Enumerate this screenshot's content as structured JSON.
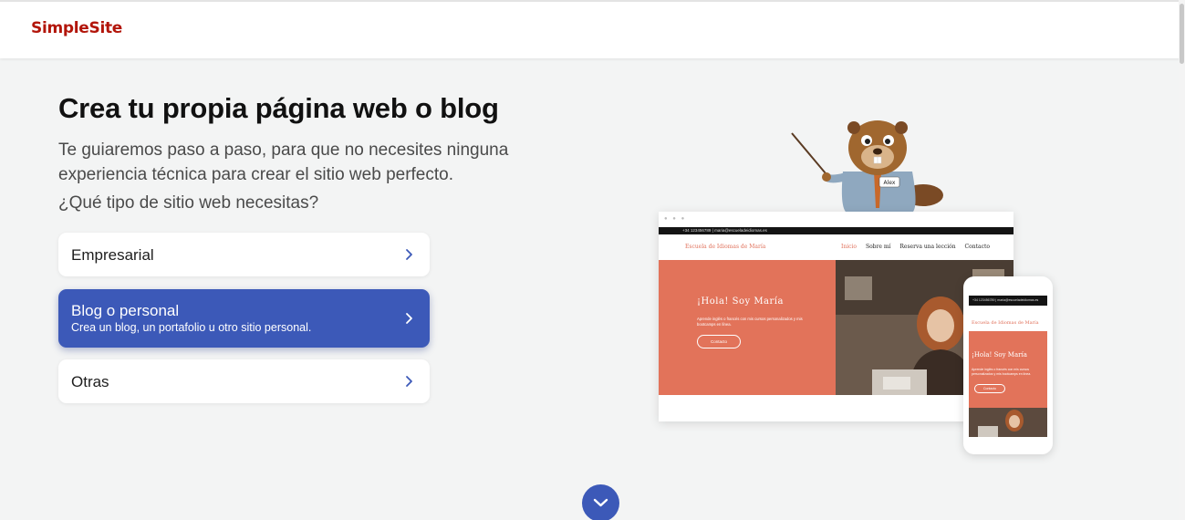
{
  "header": {
    "logo_text": "SimpleSite",
    "logo_color": "#b2150a"
  },
  "main": {
    "headline": "Crea tu propia página web o blog",
    "subtitle": "Te guiaremos paso a paso, para que no necesites ninguna experiencia técnica para crear el sitio web perfecto.",
    "question": "¿Qué tipo de sitio web necesitas?",
    "options": [
      {
        "label": "Empresarial",
        "description": "",
        "selected": false
      },
      {
        "label": "Blog o personal",
        "description": "Crea un blog, un portafolio u otro sitio personal.",
        "selected": true
      },
      {
        "label": "Otras",
        "description": "",
        "selected": false
      }
    ],
    "accent_color": "#3c59b8"
  },
  "illustration": {
    "mascot_badge": "Alex",
    "desktop": {
      "topline": "+34 123456789  |  maria@escueladeidiomas.es",
      "brand": "Escuela de Idiomas de María",
      "nav": [
        "Inicio",
        "Sobre mí",
        "Reserva una lección",
        "Contacto"
      ],
      "hero_title": "¡Hola! Soy María",
      "hero_text": "Aprende inglés o francés con mis cursos personalizados y mis bootcamps en línea.",
      "hero_button": "Contacto"
    },
    "phone": {
      "topline": "+34 123456789  |  maria@escueladeidiomas.es",
      "brand": "Escuela de Idiomas de María",
      "hero_title": "¡Hola! Soy María",
      "hero_text": "Aprende inglés o francés con mis cursos personalizados y mis bootcamps en línea.",
      "hero_button": "Contacto"
    }
  },
  "icons": {
    "option_arrow": "chevron-right-icon",
    "scroll_down": "chevron-down-icon"
  }
}
